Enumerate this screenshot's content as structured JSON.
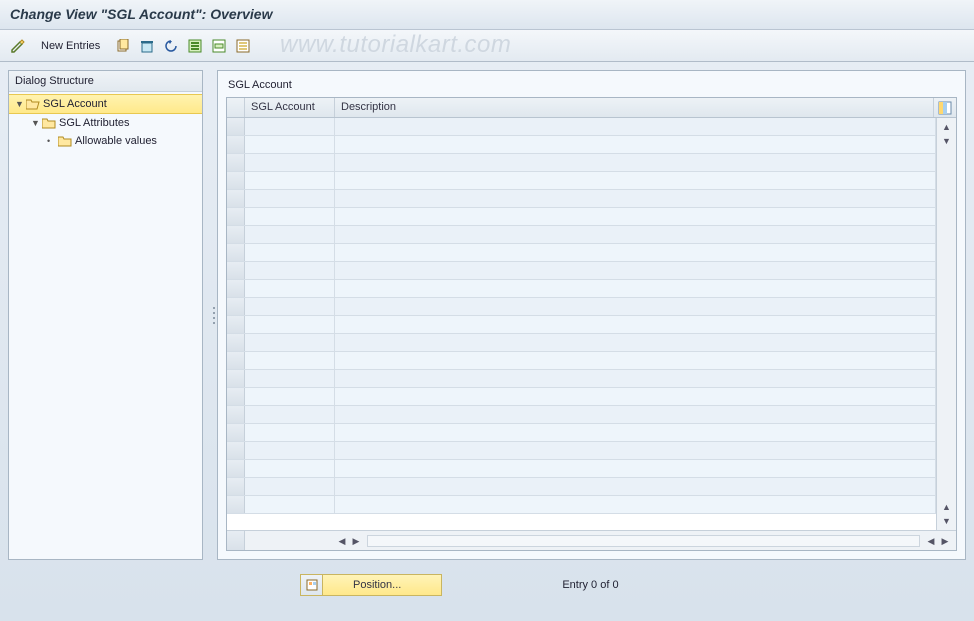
{
  "header": {
    "title": "Change View \"SGL Account\": Overview"
  },
  "toolbar": {
    "new_entries_label": "New Entries"
  },
  "watermark": "www.tutorialkart.com",
  "tree": {
    "header": "Dialog Structure",
    "nodes": [
      {
        "label": "SGL Account",
        "level": 1,
        "open": true,
        "selected": true,
        "folder_open": true
      },
      {
        "label": "SGL Attributes",
        "level": 2,
        "open": true,
        "selected": false,
        "folder_open": false
      },
      {
        "label": "Allowable values",
        "level": 3,
        "open": false,
        "selected": false,
        "folder_open": false
      }
    ]
  },
  "grid": {
    "title": "SGL Account",
    "columns": [
      {
        "key": "acct",
        "label": "SGL Account"
      },
      {
        "key": "desc",
        "label": "Description"
      }
    ],
    "rows": [
      {
        "acct": "",
        "desc": ""
      },
      {
        "acct": "",
        "desc": ""
      },
      {
        "acct": "",
        "desc": ""
      },
      {
        "acct": "",
        "desc": ""
      },
      {
        "acct": "",
        "desc": ""
      },
      {
        "acct": "",
        "desc": ""
      },
      {
        "acct": "",
        "desc": ""
      },
      {
        "acct": "",
        "desc": ""
      },
      {
        "acct": "",
        "desc": ""
      },
      {
        "acct": "",
        "desc": ""
      },
      {
        "acct": "",
        "desc": ""
      },
      {
        "acct": "",
        "desc": ""
      },
      {
        "acct": "",
        "desc": ""
      },
      {
        "acct": "",
        "desc": ""
      },
      {
        "acct": "",
        "desc": ""
      },
      {
        "acct": "",
        "desc": ""
      },
      {
        "acct": "",
        "desc": ""
      },
      {
        "acct": "",
        "desc": ""
      },
      {
        "acct": "",
        "desc": ""
      },
      {
        "acct": "",
        "desc": ""
      },
      {
        "acct": "",
        "desc": ""
      },
      {
        "acct": "",
        "desc": ""
      }
    ]
  },
  "footer": {
    "position_label": "Position...",
    "entry_text": "Entry 0 of 0"
  }
}
